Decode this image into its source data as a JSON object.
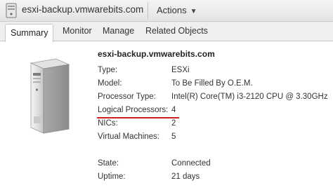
{
  "header": {
    "title": "esxi-backup.vmwarebits.com",
    "actions_label": "Actions"
  },
  "tabs": [
    {
      "label": "Summary",
      "active": true
    },
    {
      "label": "Monitor",
      "active": false
    },
    {
      "label": "Manage",
      "active": false
    },
    {
      "label": "Related Objects",
      "active": false
    }
  ],
  "summary": {
    "host_name": "esxi-backup.vmwarebits.com",
    "props": [
      {
        "label": "Type:",
        "value": "ESXi"
      },
      {
        "label": "Model:",
        "value": "To Be Filled By O.E.M."
      },
      {
        "label": "Processor Type:",
        "value": "Intel(R) Core(TM) i3-2120 CPU @ 3.30GHz"
      },
      {
        "label": "Logical Processors:",
        "value": "4"
      },
      {
        "label": "NICs:",
        "value": "2"
      },
      {
        "label": "Virtual Machines:",
        "value": "5"
      },
      {
        "label": "State:",
        "value": "Connected"
      },
      {
        "label": "Uptime:",
        "value": "21 days"
      }
    ]
  },
  "icons": {
    "host": "host-server-icon",
    "server_image": "server-tower-icon",
    "actions_caret": "chevron-down-icon"
  },
  "colors": {
    "highlight": "#d01f1f",
    "tab_bar": "#efefef"
  }
}
